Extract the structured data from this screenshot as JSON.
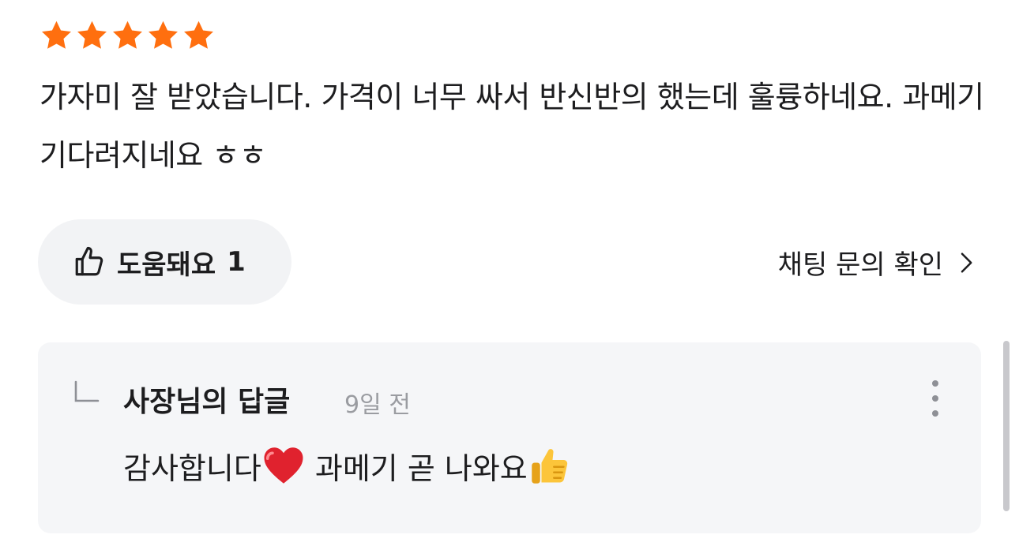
{
  "review": {
    "rating": 5,
    "max_rating": 5,
    "star_color": "#ff6f0f",
    "text": "가자미 잘 받았습니다. 가격이 너무 싸서 반신반의 했는데 훌륭하네요. 과메기 기다려지네요 ㅎㅎ"
  },
  "helpful": {
    "icon": "thumbs-up-outline-icon",
    "label": "도움돼요",
    "count": "1"
  },
  "chat_link": {
    "label": "채팅 문의 확인",
    "icon": "chevron-right-icon"
  },
  "reply": {
    "icon": "reply-arrow-icon",
    "author": "사장님의 답글",
    "time": "9일 전",
    "text_part1": "감사합니다",
    "emoji1": "red-heart-emoji",
    "text_part2": " 과메기 곧 나와요",
    "emoji2": "thumbs-up-emoji",
    "more_icon": "more-vertical-icon"
  }
}
